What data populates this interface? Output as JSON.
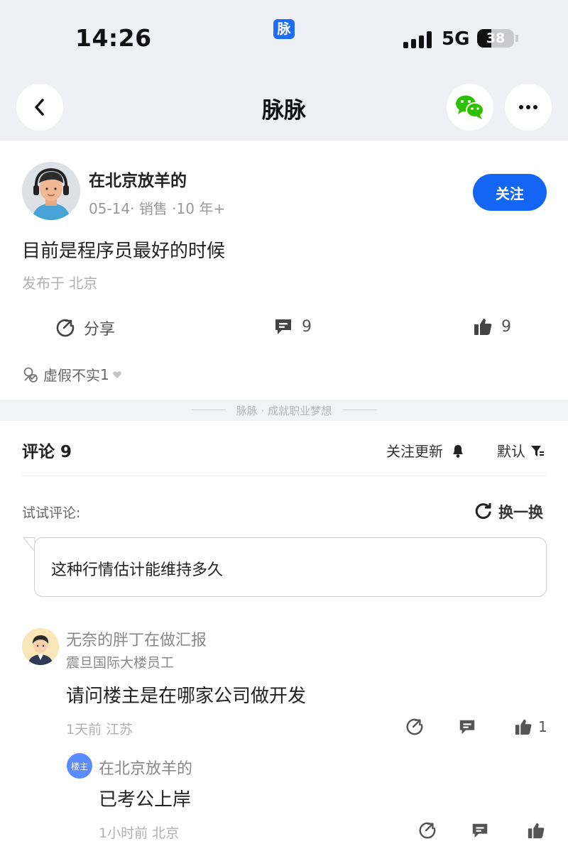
{
  "status_bar": {
    "time": "14:26",
    "app_badge": "脉",
    "network": "5G",
    "battery": "38",
    "battery_level": 0.38
  },
  "nav": {
    "title": "脉脉",
    "back_icon": "chevron-left-icon",
    "share_icon": "wechat-icon",
    "more_icon": "more-icon"
  },
  "post": {
    "author_name": "在北京放羊的",
    "author_meta": "05-14· 销售 ·10 年+",
    "follow_label": "关注",
    "text": "目前是程序员最好的时候",
    "location": "发布于 北京",
    "actions": {
      "share_label": "分享",
      "comment_count": "9",
      "like_count": "9"
    },
    "fake_label": "虚假不实",
    "fake_count": "1"
  },
  "slogan": "脉脉 · 成就职业梦想",
  "comments_header": {
    "title": "评论 9",
    "follow_updates": "关注更新",
    "sort": "默认"
  },
  "suggestion": {
    "label": "试试评论:",
    "refresh": "换一换",
    "text": "这种行情估计能维持多久"
  },
  "comment": {
    "name": "无奈的胖丁在做汇报",
    "title": "震旦国际大楼员工",
    "text": "请问楼主是在哪家公司做开发",
    "meta": "1天前  江苏",
    "like_count": "1"
  },
  "reply": {
    "badge": "楼主",
    "name": "在北京放羊的",
    "text": "已考公上岸",
    "meta": "1小时前  北京"
  },
  "colors": {
    "accent": "#1565f5",
    "wechat_green": "#2dc100",
    "top_bg": "#eff0f4"
  }
}
